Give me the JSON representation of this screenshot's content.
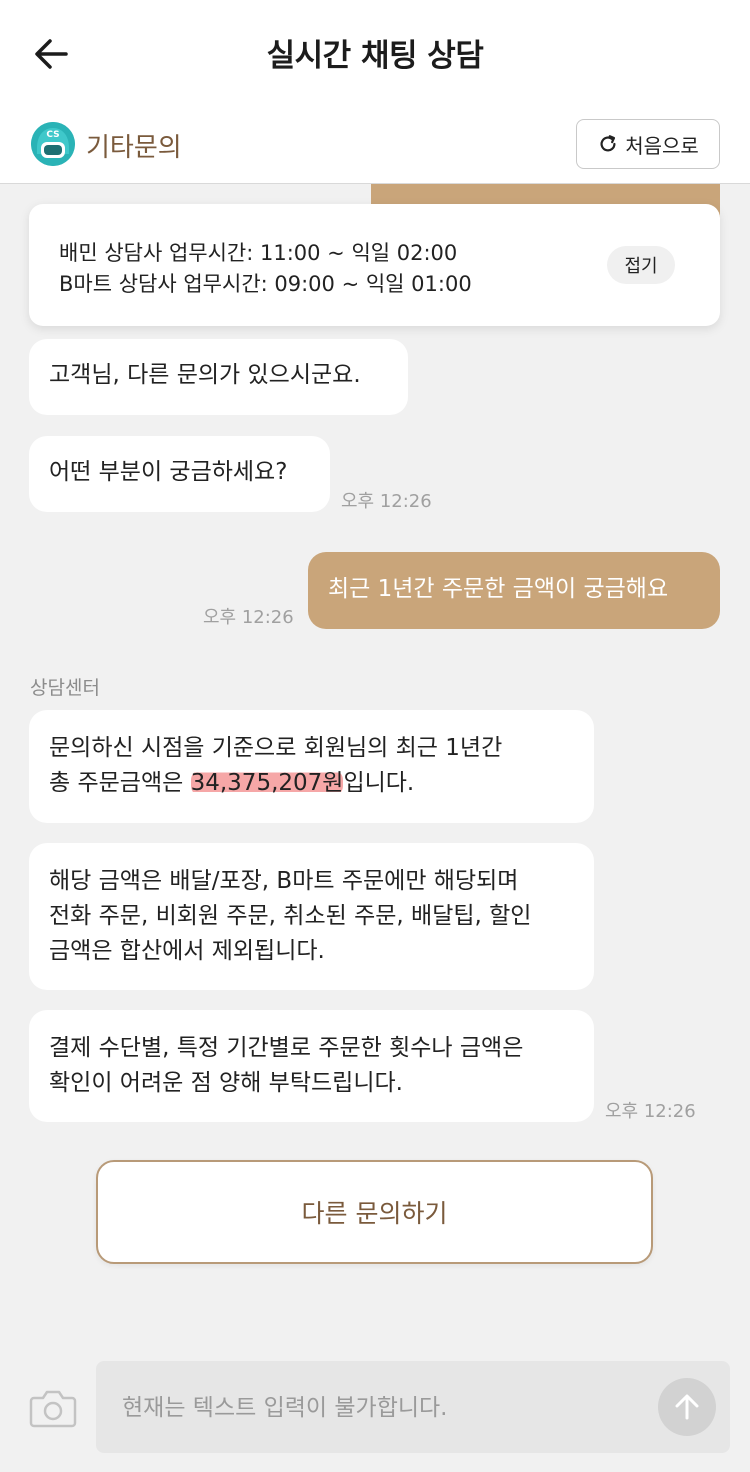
{
  "header": {
    "title": "실시간 채팅 상담"
  },
  "subheader": {
    "category": "기타문의",
    "restart_label": "처음으로"
  },
  "notice": {
    "line1": "배민 상담사 업무시간: 11:00 ~ 익일 02:00",
    "line2": "B마트 상담사 업무시간: 09:00 ~ 익일 01:00",
    "collapse_label": "접기"
  },
  "messages": {
    "bot1": "고객님, 다른 문의가 있으시군요.",
    "bot2": "어떤 부분이 궁금하세요?",
    "bot2_time": "오후 12:26",
    "me1": "최근 1년간 주문한 금액이 궁금해요",
    "me1_time": "오후 12:26",
    "sender_label": "상담센터",
    "reply1_line1": "문의하신 시점을 기준으로 회원님의 최근 1년간",
    "reply1_prefix": "총 주문금액은 ",
    "reply1_amount": "34,375,207원",
    "reply1_suffix": "입니다.",
    "reply2_line1": "해당 금액은 배달/포장, B마트 주문에만 해당되며",
    "reply2_line2": "전화 주문, 비회원 주문, 취소된 주문, 배달팁, 할인",
    "reply2_line3": "금액은 합산에서 제외됩니다.",
    "reply3_line1": "결제 수단별, 특정 기간별로 주문한 횟수나 금액은",
    "reply3_line2": "확인이 어려운 점 양해 부탁드립니다.",
    "reply3_time": "오후 12:26"
  },
  "actions": {
    "other_inquiry": "다른 문의하기"
  },
  "input": {
    "placeholder": "현재는 텍스트 입력이 불가합니다."
  },
  "colors": {
    "accent": "#c9a57a",
    "accent_text": "#7a5a3c",
    "background": "#f1f1f1",
    "highlight": "#f6a7a7"
  },
  "icons": {
    "back": "arrow-left-icon",
    "avatar": "cs-helmet-avatar",
    "restart": "refresh-icon",
    "camera": "camera-icon",
    "send": "arrow-up-icon"
  }
}
